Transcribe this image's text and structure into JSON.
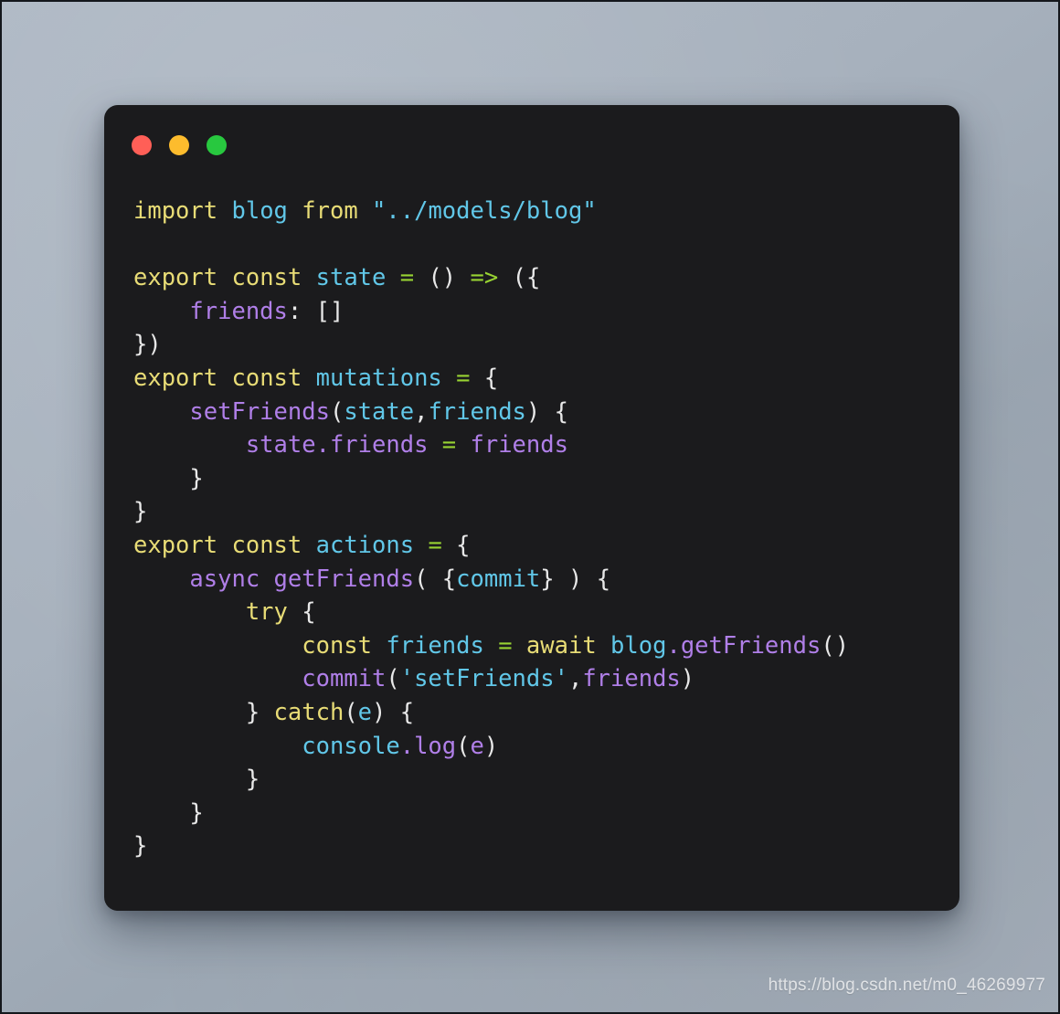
{
  "window": {
    "controls": [
      {
        "name": "close",
        "label": "Close",
        "color": "#ff5f57"
      },
      {
        "name": "minimize",
        "label": "Minimize",
        "color": "#fdbc2d"
      },
      {
        "name": "maximize",
        "label": "Maximize",
        "color": "#28c83f"
      }
    ],
    "background_color": "#1b1b1d"
  },
  "desktop": {
    "background_color": "#a7b1bd"
  },
  "theme": {
    "keyword": "#e8dc76",
    "identifier": "#61c7e8",
    "string": "#61c7e8",
    "operator": "#98d332",
    "punctuation": "#e8e8e8",
    "function": "#b07fe8",
    "property": "#b07fe8",
    "plain": "#e8e8e8"
  },
  "code": {
    "language": "javascript",
    "full_text": "import blog from \"../models/blog\"\n\nexport const state = () => ({\n    friends: []\n})\nexport const mutations = {\n    setFriends(state,friends) {\n        state.friends = friends\n    }\n}\nexport const actions = {\n    async getFriends( {commit} ) {\n        try {\n            const friends = await blog.getFriends()\n            commit('setFriends',friends)\n        } catch(e) {\n            console.log(e)\n        }\n    }\n}",
    "lines": [
      {
        "n": 1,
        "text": "import blog from \"../models/blog\""
      },
      {
        "n": 2,
        "text": ""
      },
      {
        "n": 3,
        "text": "export const state = () => ({"
      },
      {
        "n": 4,
        "text": "    friends: []"
      },
      {
        "n": 5,
        "text": "})"
      },
      {
        "n": 6,
        "text": "export const mutations = {"
      },
      {
        "n": 7,
        "text": "    setFriends(state,friends) {"
      },
      {
        "n": 8,
        "text": "        state.friends = friends"
      },
      {
        "n": 9,
        "text": "    }"
      },
      {
        "n": 10,
        "text": "}"
      },
      {
        "n": 11,
        "text": "export const actions = {"
      },
      {
        "n": 12,
        "text": "    async getFriends( {commit} ) {"
      },
      {
        "n": 13,
        "text": "        try {"
      },
      {
        "n": 14,
        "text": "            const friends = await blog.getFriends()"
      },
      {
        "n": 15,
        "text": "            commit('setFriends',friends)"
      },
      {
        "n": 16,
        "text": "        } catch(e) {"
      },
      {
        "n": 17,
        "text": "            console.log(e)"
      },
      {
        "n": 18,
        "text": "        }"
      },
      {
        "n": 19,
        "text": "    }"
      },
      {
        "n": 20,
        "text": "}"
      }
    ],
    "tokens": {
      "l1_import": "import",
      "l1_sp1": " ",
      "l1_blog": "blog",
      "l1_sp2": " ",
      "l1_from": "from",
      "l1_sp3": " ",
      "l1_path": "\"../models/blog\"",
      "l3_export": "export",
      "l3_const": "const",
      "l3_state": "state",
      "l3_eq": "=",
      "l3_parens": "()",
      "l3_arrow": "=>",
      "l3_open": "({",
      "l4_indent": "    ",
      "l4_friends": "friends",
      "l4_colon": ":",
      "l4_brackets": "[]",
      "l5_close": "})",
      "l6_export": "export",
      "l6_const": "const",
      "l6_mutations": "mutations",
      "l6_eq": "=",
      "l6_brace": "{",
      "l7_indent": "    ",
      "l7_setFriends": "setFriends",
      "l7_lparen": "(",
      "l7_state": "state",
      "l7_comma": ",",
      "l7_friends": "friends",
      "l7_rparen": ")",
      "l7_brace": "{",
      "l8_indent": "        ",
      "l8_state": "state",
      "l8_dot": ".",
      "l8_friends": "friends",
      "l8_eq": "=",
      "l8_rhs": "friends",
      "l9_brace": "    }",
      "l10_brace": "}",
      "l11_export": "export",
      "l11_const": "const",
      "l11_actions": "actions",
      "l11_eq": "=",
      "l11_brace": "{",
      "l12_indent": "    ",
      "l12_async": "async",
      "l12_getFriends": "getFriends",
      "l12_lparen": "( ",
      "l12_lbrace": "{",
      "l12_commit": "commit",
      "l12_rbrace": "}",
      "l12_rparen": " ) ",
      "l12_brace": "{",
      "l13_indent": "        ",
      "l13_try": "try",
      "l13_brace": "{",
      "l14_indent": "            ",
      "l14_const": "const",
      "l14_friends": "friends",
      "l14_eq": "=",
      "l14_await": "await",
      "l14_blog": "blog",
      "l14_dot": ".",
      "l14_getFriends": "getFriends",
      "l14_parens": "()",
      "l15_indent": "            ",
      "l15_commit": "commit",
      "l15_lparen": "(",
      "l15_str": "'setFriends'",
      "l15_comma": ",",
      "l15_friends": "friends",
      "l15_rparen": ")",
      "l16_indent": "        ",
      "l16_rbrace": "} ",
      "l16_catch": "catch",
      "l16_lparen": "(",
      "l16_e": "e",
      "l16_rparen": ")",
      "l16_brace": "{",
      "l17_indent": "            ",
      "l17_console": "console",
      "l17_dot": ".",
      "l17_log": "log",
      "l17_lparen": "(",
      "l17_e": "e",
      "l17_rparen": ")",
      "l18_brace": "        }",
      "l19_brace": "    }",
      "l20_brace": "}"
    }
  },
  "watermark": {
    "text": "https://blog.csdn.net/m0_46269977"
  }
}
